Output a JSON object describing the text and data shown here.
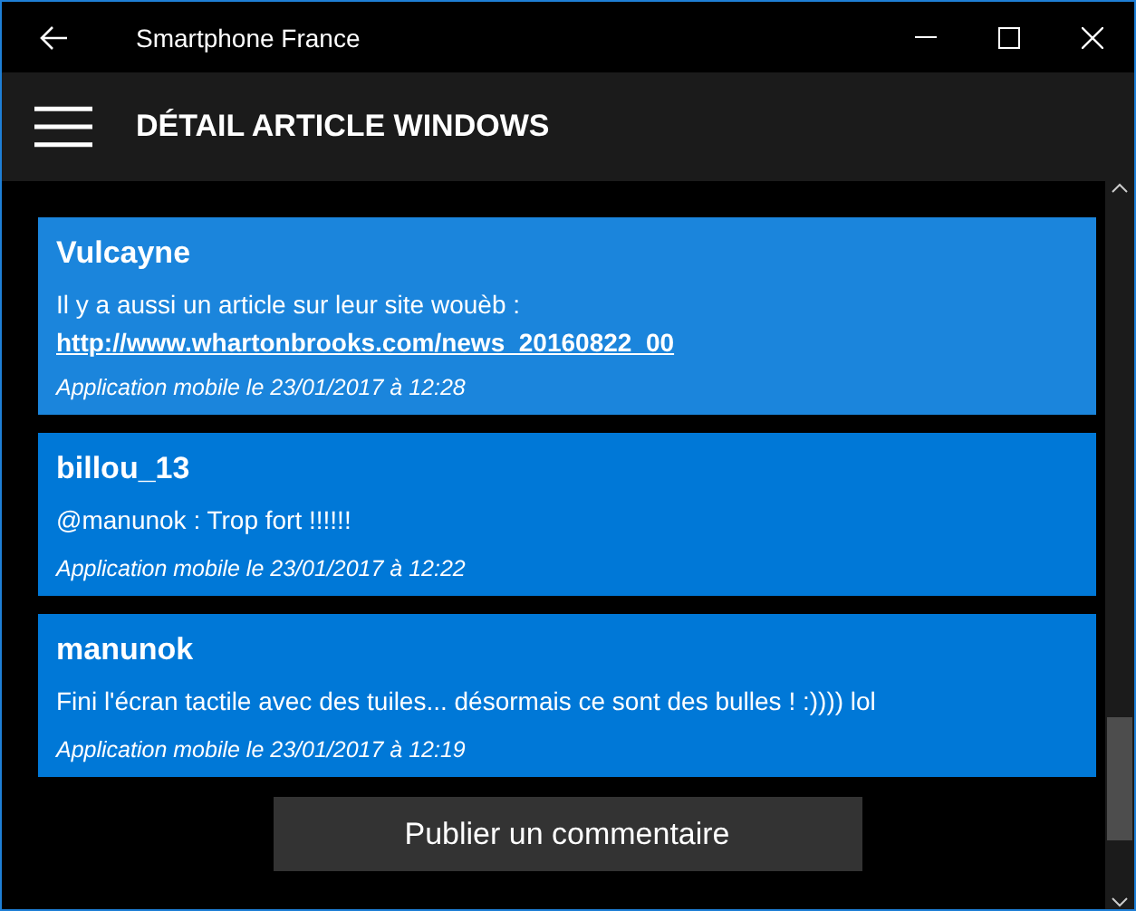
{
  "window": {
    "title": "Smartphone France"
  },
  "header": {
    "title": "DÉTAIL ARTICLE WINDOWS"
  },
  "comments": [
    {
      "author": "Vulcayne",
      "text": "Il y a aussi un article sur leur site wouèb :",
      "link": "http://www.whartonbrooks.com/news_20160822_00",
      "meta": "Application mobile le 23/01/2017 à 12:28",
      "selected": true
    },
    {
      "author": "billou_13",
      "text": "@manunok : Trop fort !!!!!!",
      "meta": "Application mobile le 23/01/2017 à 12:22",
      "selected": false
    },
    {
      "author": "manunok",
      "text": "Fini  l'écran tactile avec des tuiles... désormais ce sont des bulles ! :)))) lol",
      "meta": "Application mobile le 23/01/2017 à 12:19",
      "selected": false
    }
  ],
  "publish_button": {
    "label": "Publier un commentaire"
  }
}
